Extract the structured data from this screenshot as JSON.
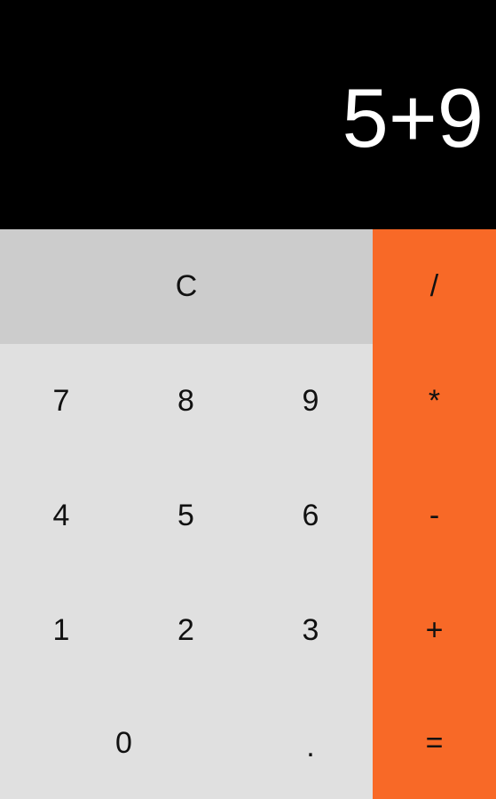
{
  "display": {
    "expression": "5+9"
  },
  "keys": {
    "clear": "C",
    "divide": "/",
    "multiply": "*",
    "subtract": "-",
    "add": "+",
    "equals": "=",
    "seven": "7",
    "eight": "8",
    "nine": "9",
    "four": "4",
    "five": "5",
    "six": "6",
    "one": "1",
    "two": "2",
    "three": "3",
    "zero": "0",
    "decimal": "."
  },
  "colors": {
    "display_bg": "#000000",
    "display_text": "#ffffff",
    "clear_row_bg": "#cccccc",
    "number_pad_bg": "#e0e0e0",
    "operator_bg": "#f86927"
  }
}
